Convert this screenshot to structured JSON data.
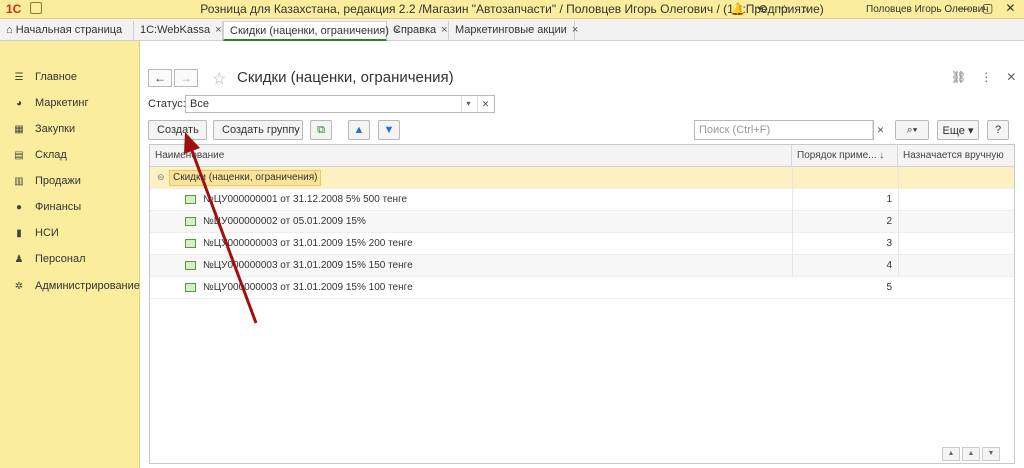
{
  "window": {
    "logo": "1С",
    "title": "Розница для Казахстана, редакция 2.2 /Магазин \"Автозапчасти\" / Половцев Игорь Олегович /  (1С:Предприятие)",
    "user": "Половцев Игорь Олегович",
    "controls": [
      "—",
      "▢",
      "✕"
    ]
  },
  "tabs": [
    {
      "label": "Начальная страница"
    },
    {
      "label": "1С:WebKassa",
      "close": "×"
    },
    {
      "label": "Скидки (наценки, ограничения)",
      "close": "×"
    },
    {
      "label": "Справка",
      "close": "×"
    },
    {
      "label": "Маркетинговые акции",
      "close": "×"
    }
  ],
  "sidebar": {
    "items": [
      {
        "label": "Главное",
        "icon": "☰"
      },
      {
        "label": "Маркетинг",
        "icon": "◕"
      },
      {
        "label": "Закупки",
        "icon": "▦"
      },
      {
        "label": "Склад",
        "icon": "▤"
      },
      {
        "label": "Продажи",
        "icon": "▥"
      },
      {
        "label": "Финансы",
        "icon": "●"
      },
      {
        "label": "НСИ",
        "icon": "▮"
      },
      {
        "label": "Персонал",
        "icon": "♟"
      },
      {
        "label": "Администрирование",
        "icon": "✲"
      }
    ]
  },
  "page": {
    "title": "Скидки (наценки, ограничения)",
    "back": "←",
    "forward": "→",
    "star": "☆",
    "status_label": "Статус:",
    "status_value": "Все",
    "buttons": {
      "create": "Создать",
      "create_group": "Создать группу",
      "more": "Еще",
      "help": "?"
    },
    "search_placeholder": "Поиск (Ctrl+F)"
  },
  "table": {
    "columns": [
      "Наименование",
      "Порядок приме... ↓",
      "Назначается вручную"
    ],
    "group": {
      "label": "Скидки (наценки, ограничения)",
      "toggle": "⊖"
    },
    "rows": [
      {
        "name": "№ЦУ000000001 от 31.12.2008 5% 500 тенге",
        "order": "1"
      },
      {
        "name": "№ЦУ000000002 от 05.01.2009 15%",
        "order": "2"
      },
      {
        "name": "№ЦУ000000003 от 31.01.2009 15% 200 тенге",
        "order": "3"
      },
      {
        "name": "№ЦУ000000003 от 31.01.2009 15% 150 тенге",
        "order": "4"
      },
      {
        "name": "№ЦУ000000003 от 31.01.2009 15% 100 тенге",
        "order": "5"
      }
    ]
  },
  "colors": {
    "accent_yellow": "#fbed9e",
    "group_highlight": "#fdf1c2",
    "active_tab_underline": "#2d7d2d",
    "annotation_arrow": "#a01010"
  }
}
